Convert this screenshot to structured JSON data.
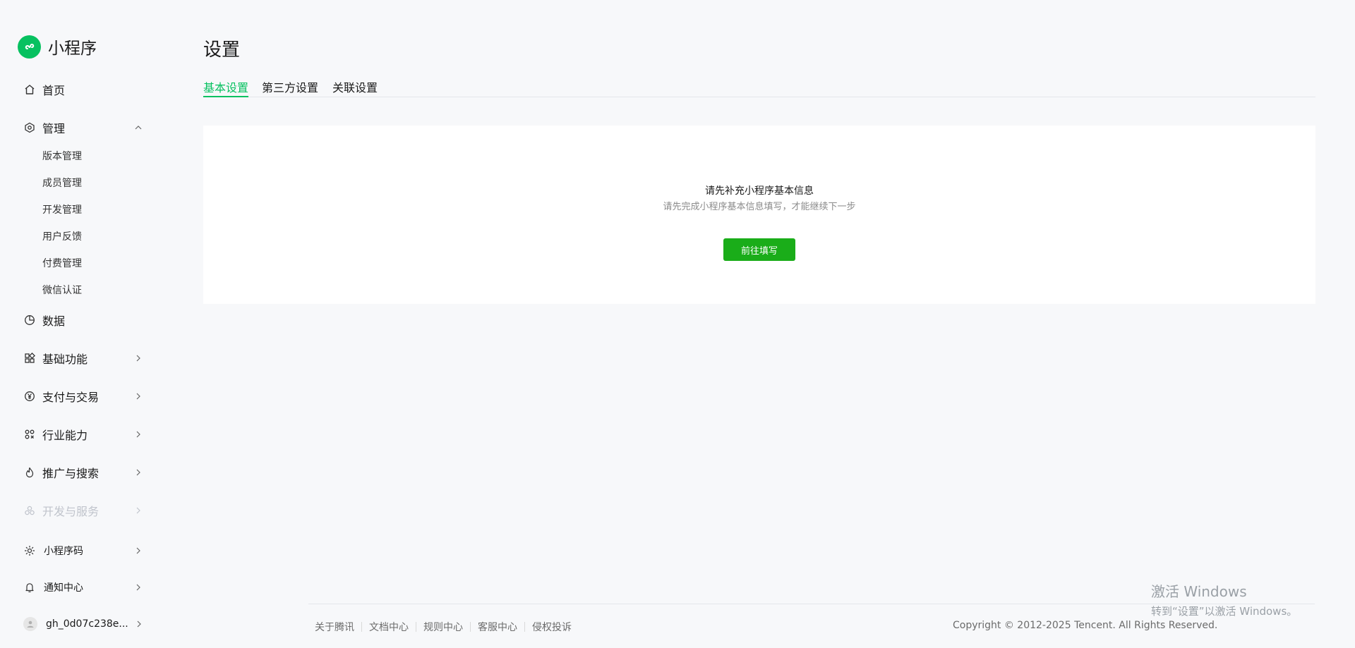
{
  "app": {
    "name": "小程序"
  },
  "sidebar": {
    "home": "首页",
    "manage": "管理",
    "manage_sub": [
      "版本管理",
      "成员管理",
      "开发管理",
      "用户反馈",
      "付费管理",
      "微信认证"
    ],
    "data": "数据",
    "basic": "基础功能",
    "payment": "支付与交易",
    "industry": "行业能力",
    "promotion": "推广与搜索",
    "devservice": "开发与服务",
    "qrcode": "小程序码",
    "notify": "通知中心",
    "account": "gh_0d07c238e..."
  },
  "page": {
    "title": "设置",
    "tabs": [
      "基本设置",
      "第三方设置",
      "关联设置"
    ],
    "active_tab": 0,
    "card": {
      "title": "请先补充小程序基本信息",
      "desc": "请先完成小程序基本信息填写，才能继续下一步",
      "button": "前往填写"
    }
  },
  "footer": {
    "links": [
      "关于腾讯",
      "文档中心",
      "规则中心",
      "客服中心",
      "侵权投诉"
    ],
    "copyright": "Copyright © 2012-2025 Tencent. All Rights Reserved."
  },
  "watermark": {
    "title": "激活 Windows",
    "sub": "转到“设置”以激活 Windows。"
  },
  "colors": {
    "accent": "#07c160",
    "button": "#1aad19"
  }
}
